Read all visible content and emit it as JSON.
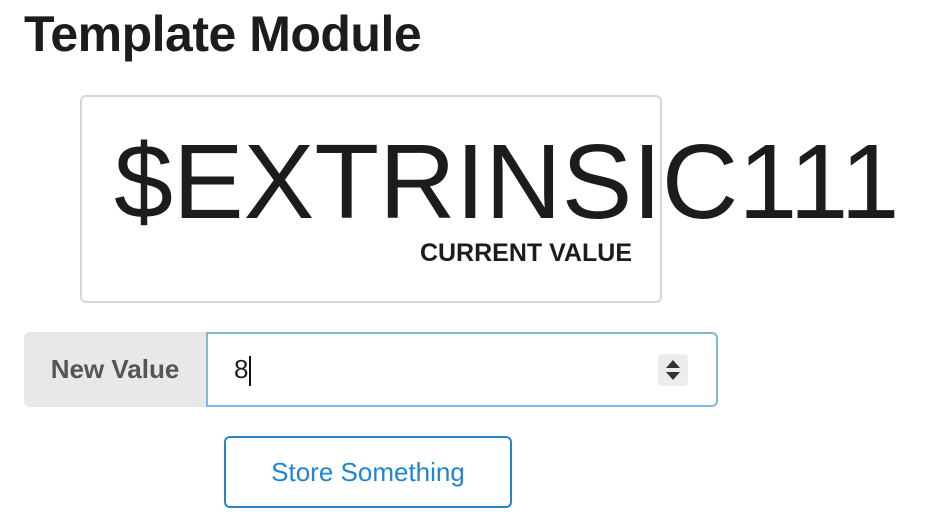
{
  "page": {
    "title": "Template Module"
  },
  "statistic": {
    "value": "$EXTRINSIC111",
    "label": "CURRENT VALUE"
  },
  "form": {
    "input_label": "New Value",
    "input_value": "8",
    "button_label": "Store Something"
  },
  "colors": {
    "button_accent": "#2185d0",
    "input_focus_border": "#85b7d9",
    "label_background": "#e8e8e8"
  }
}
